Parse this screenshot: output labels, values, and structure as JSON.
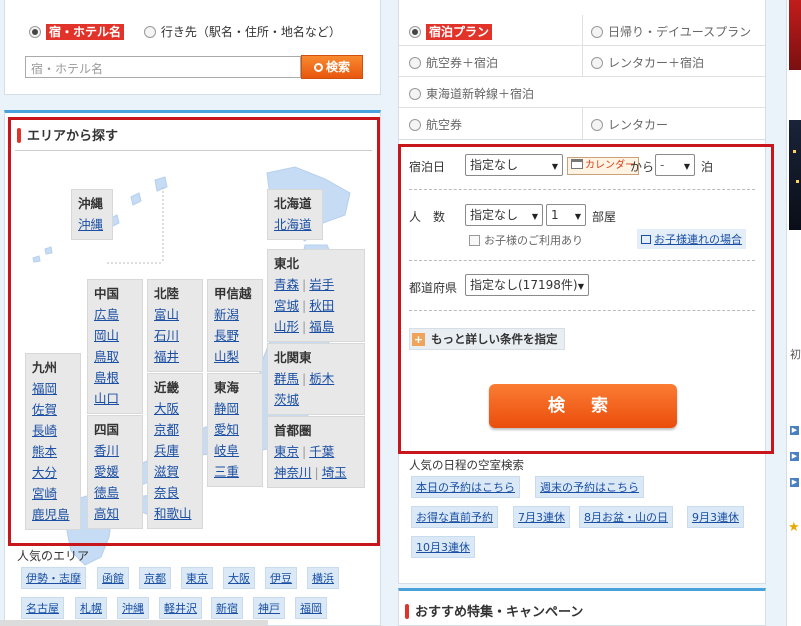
{
  "hotel_search": {
    "radio_hotel": "宿・ホテル名",
    "radio_dest": "行き先（駅名・住所・地名など）",
    "input_placeholder": "宿・ホテル名",
    "search_button": "検索"
  },
  "area": {
    "title": "エリアから探す",
    "okinawa": {
      "title": "沖縄",
      "links": [
        "沖縄"
      ]
    },
    "hokkaido": {
      "title": "北海道",
      "links": [
        "北海道"
      ]
    },
    "tohoku": {
      "title": "東北",
      "links": [
        "青森",
        "岩手",
        "宮城",
        "秋田",
        "山形",
        "福島"
      ]
    },
    "kitakanto": {
      "title": "北関東",
      "links": [
        "群馬",
        "栃木",
        "茨城"
      ]
    },
    "shutoken": {
      "title": "首都圏",
      "links": [
        "東京",
        "千葉",
        "神奈川",
        "埼玉"
      ]
    },
    "koshinetsu": {
      "title": "甲信越",
      "links": [
        "新潟",
        "長野",
        "山梨"
      ]
    },
    "tokai": {
      "title": "東海",
      "links": [
        "静岡",
        "愛知",
        "岐阜",
        "三重"
      ]
    },
    "hokuriku": {
      "title": "北陸",
      "links": [
        "富山",
        "石川",
        "福井"
      ]
    },
    "kinki": {
      "title": "近畿",
      "links": [
        "大阪",
        "京都",
        "兵庫",
        "滋賀",
        "奈良",
        "和歌山"
      ]
    },
    "chugoku": {
      "title": "中国",
      "links": [
        "広島",
        "岡山",
        "鳥取",
        "島根",
        "山口"
      ]
    },
    "shikoku": {
      "title": "四国",
      "links": [
        "香川",
        "愛媛",
        "徳島",
        "高知"
      ]
    },
    "kyushu": {
      "title": "九州",
      "links": [
        "福岡",
        "佐賀",
        "長崎",
        "熊本",
        "大分",
        "宮崎",
        "鹿児島"
      ]
    }
  },
  "popular_area": {
    "title": "人気のエリア",
    "tags": [
      "伊勢・志摩",
      "函館",
      "京都",
      "東京",
      "大阪",
      "伊豆",
      "横浜",
      "名古屋",
      "札幌",
      "沖縄",
      "軽井沢",
      "新宿",
      "神戸",
      "福岡"
    ]
  },
  "plans": {
    "items": [
      "宿泊プラン",
      "日帰り・デイユースプラン",
      "航空券＋宿泊",
      "レンタカー＋宿泊",
      "東海道新幹線＋宿泊",
      "航空券",
      "レンタカー"
    ]
  },
  "form": {
    "stay_date_label": "宿泊日",
    "stay_date_value": "指定なし",
    "calendar_label": "カレンダー",
    "from_label": "から",
    "nights_value": "-",
    "nights_unit": "泊",
    "people_label": "人　数",
    "people_value": "指定なし",
    "rooms_value": "1",
    "rooms_unit": "部屋",
    "child_checkbox": "お子様のご利用あり",
    "child_link": "お子様連れの場合",
    "pref_label": "都道府県",
    "pref_value": "指定なし(17198件)",
    "more_conditions": "もっと詳しい条件を指定",
    "search_button": "検 索"
  },
  "schedule": {
    "title": "人気の日程の空室検索",
    "tags": [
      "本日の予約はこちら",
      "週末の予約はこちら",
      "お得な直前予約",
      "7月3連休",
      "8月お盆・山の日",
      "9月3連休",
      "10月3連休"
    ]
  },
  "campaign": {
    "title": "おすすめ特集・キャンペーン"
  },
  "right_col": {
    "text": "初"
  },
  "colors": {
    "accent": "#e8560e",
    "highlight": "#c8161d",
    "link": "#1a4fa3"
  }
}
